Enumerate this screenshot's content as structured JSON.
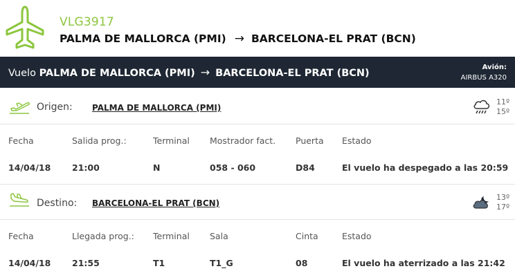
{
  "flight": {
    "code": "VLG3917",
    "origin": "PALMA DE MALLORCA (PMI)",
    "destination": "BARCELONA-EL PRAT (BCN)"
  },
  "bar": {
    "prefix": "Vuelo",
    "origin": "PALMA DE MALLORCA (PMI)",
    "destination": "BARCELONA-EL PRAT (BCN)",
    "aircraft_label": "Avión:",
    "aircraft_value": "AIRBUS A320"
  },
  "origin": {
    "label": "Origen:",
    "airport": "PALMA DE MALLORCA (PMI)",
    "weather_icon": "rain-cloud-icon",
    "temp_low": "11º",
    "temp_high": "15º",
    "headers": [
      "Fecha",
      "Salida prog.:",
      "Terminal",
      "Mostrador fact.",
      "Puerta",
      "Estado"
    ],
    "values": [
      "14/04/18",
      "21:00",
      "N",
      "058 - 060",
      "D84",
      "El vuelo ha despegado a las 20:59"
    ]
  },
  "destination": {
    "label": "Destino:",
    "airport": "BARCELONA-EL PRAT (BCN)",
    "weather_icon": "cloudy-night-icon",
    "temp_low": "13º",
    "temp_high": "17º",
    "headers": [
      "Fecha",
      "Llegada prog.:",
      "Terminal",
      "Sala",
      "Cinta",
      "Estado"
    ],
    "values": [
      "14/04/18",
      "21:55",
      "T1",
      "T1_G",
      "08",
      "El vuelo ha aterrizado a las 21:42"
    ]
  },
  "colors": {
    "accent": "#8cc63e",
    "bar_bg": "#1e2733"
  }
}
